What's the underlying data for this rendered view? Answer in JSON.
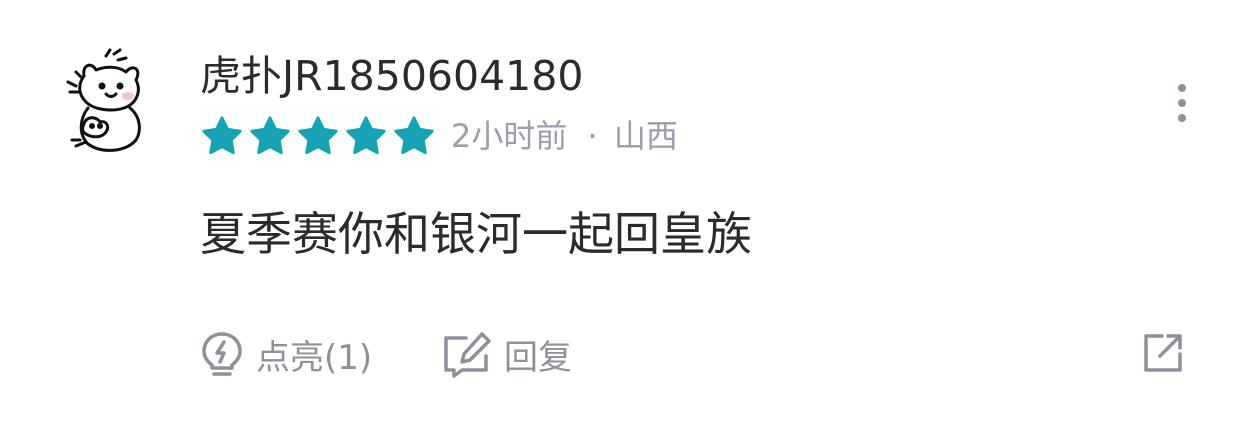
{
  "comment_card": {
    "username": "虎扑JR1850604180",
    "rating": 5,
    "rating_max": 5,
    "star_color": "#17a2b8",
    "time": "2小时前",
    "separator": "·",
    "location": "山西",
    "content": "夏季赛你和银河一起回皇族",
    "actions": {
      "like_label": "点亮(1)",
      "reply_label": "回复"
    },
    "icons": {
      "avatar": "cartoon-bear-avatar",
      "more": "more-vertical-icon",
      "like": "lightbulb-icon",
      "reply": "edit-icon",
      "share": "external-share-icon"
    }
  }
}
